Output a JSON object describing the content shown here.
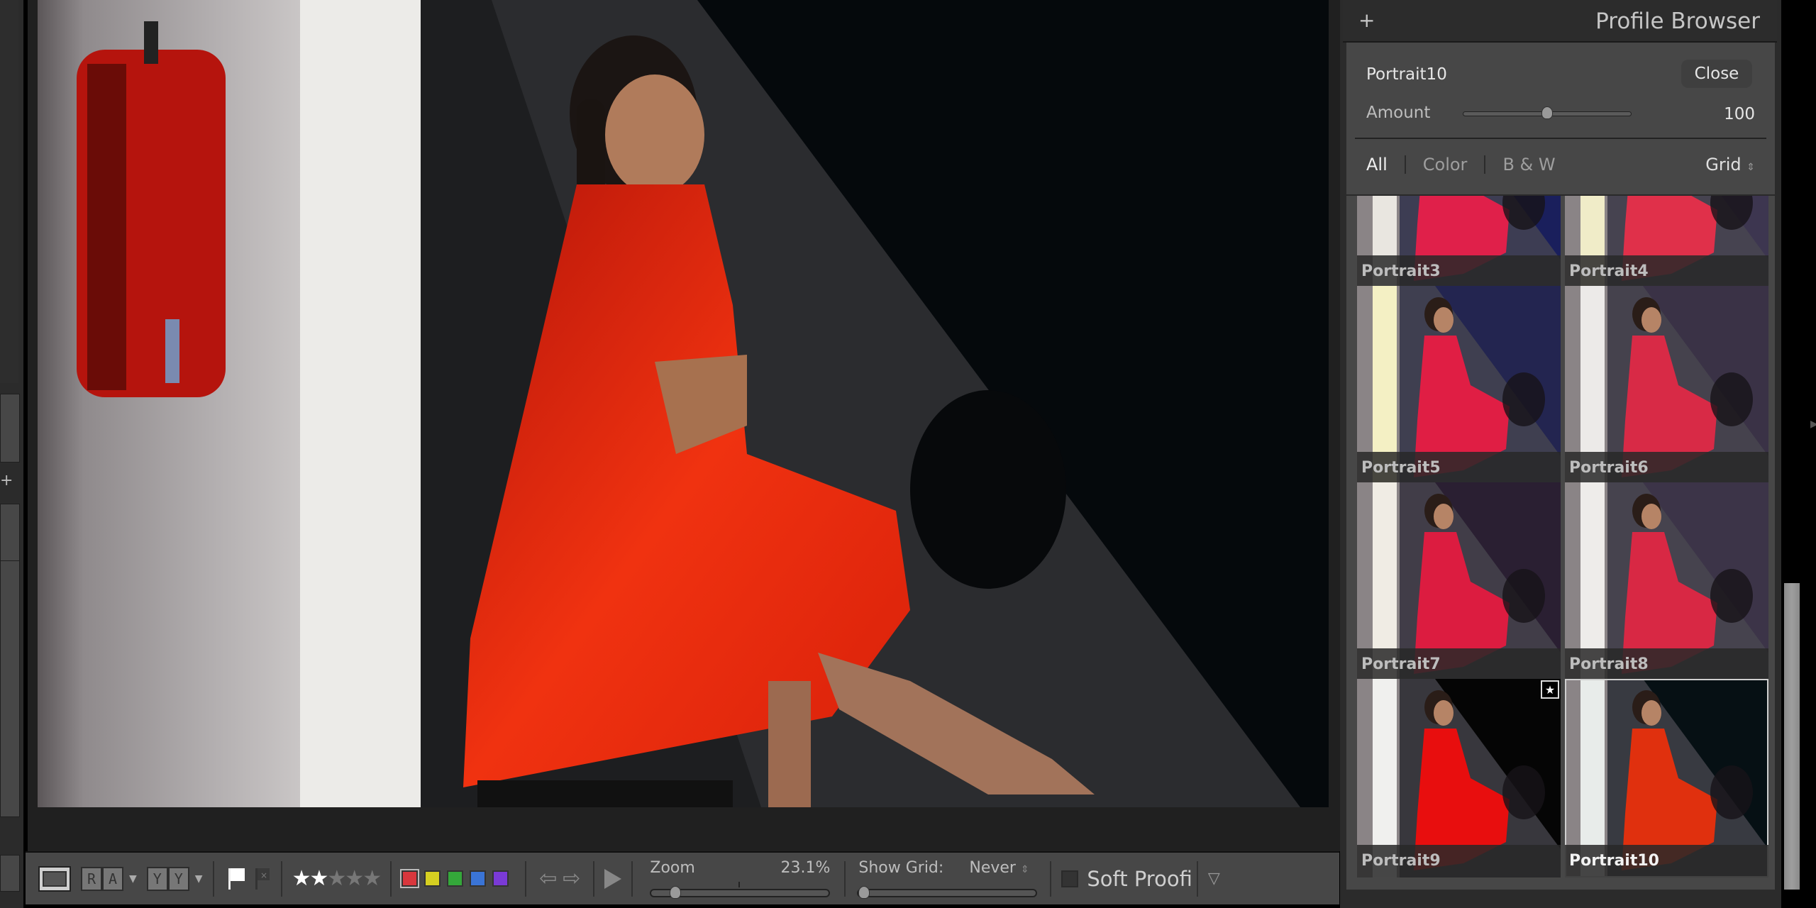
{
  "photo": {
    "description": "Girl in red dress seated against dark wall beside fire extinguisher",
    "colors": {
      "wall_light": "#e9e6e4",
      "wall_shadow": "#2b2c2f",
      "dark_bg": "#05090c",
      "dress": "#e8250e",
      "extinguisher": "#c4170f"
    }
  },
  "toolbar": {
    "view_icon": "loupe-view-icon",
    "before_after_lr": [
      "R",
      "A"
    ],
    "before_after_yy": [
      "Y",
      "Y"
    ],
    "flag_pick_icon": "flag-pick-icon",
    "flag_reject_icon": "flag-reject-icon",
    "rating": {
      "value": 2,
      "max": 5,
      "star_glyph": "★"
    },
    "color_labels": [
      {
        "name": "red",
        "hex": "#d8373d",
        "selected": true
      },
      {
        "name": "yellow",
        "hex": "#d6cf21"
      },
      {
        "name": "green",
        "hex": "#34a83a"
      },
      {
        "name": "blue",
        "hex": "#3a74d6"
      },
      {
        "name": "purple",
        "hex": "#7a3ad6"
      }
    ],
    "prev_glyph": "⇦",
    "next_glyph": "⇨",
    "zoom_label": "Zoom",
    "zoom_value": "23.1%",
    "zoom_slider_fraction": 0.08,
    "show_grid_label": "Show Grid:",
    "show_grid_value": "Never",
    "show_grid_slider_fraction": 0.0,
    "soft_proofing_label": "Soft Proofi",
    "soft_proofing_checked": false,
    "menu_glyph": "▽"
  },
  "profile_browser": {
    "title": "Profile Browser",
    "add_glyph": "+",
    "current_profile": "Portrait10",
    "close_label": "Close",
    "amount_label": "Amount",
    "amount_value": "100",
    "amount_slider_fraction": 0.5,
    "filters": [
      {
        "label": "All",
        "active": true
      },
      {
        "label": "Color",
        "active": false
      },
      {
        "label": "B & W",
        "active": false
      }
    ],
    "view_mode": "Grid",
    "view_mode_glyph": "⇕",
    "profiles": [
      {
        "name": "Portrait3",
        "tint": "#1a1f5c",
        "dress": "#e0204a",
        "wall": "#e9e6e0",
        "favorite": false,
        "selected": false
      },
      {
        "name": "Portrait4",
        "tint": "#3d3650",
        "dress": "#e0304a",
        "wall": "#f0ecc8",
        "favorite": false,
        "selected": false
      },
      {
        "name": "Portrait5",
        "tint": "#232550",
        "dress": "#e01e44",
        "wall": "#f4f0c4",
        "favorite": false,
        "selected": false
      },
      {
        "name": "Portrait6",
        "tint": "#3a3246",
        "dress": "#d82a46",
        "wall": "#eceae8",
        "favorite": false,
        "selected": false
      },
      {
        "name": "Portrait7",
        "tint": "#2a1f32",
        "dress": "#dc1c40",
        "wall": "#f0ece4",
        "favorite": false,
        "selected": false
      },
      {
        "name": "Portrait8",
        "tint": "#3c3448",
        "dress": "#d82844",
        "wall": "#eeecea",
        "favorite": false,
        "selected": false
      },
      {
        "name": "Portrait9",
        "tint": "#050505",
        "dress": "#e80e0e",
        "wall": "#f0f0ee",
        "favorite": true,
        "selected": false
      },
      {
        "name": "Portrait10",
        "tint": "#061014",
        "dress": "#e0300e",
        "wall": "#e8ecea",
        "favorite": false,
        "selected": true
      }
    ],
    "favorite_glyph": "★"
  }
}
